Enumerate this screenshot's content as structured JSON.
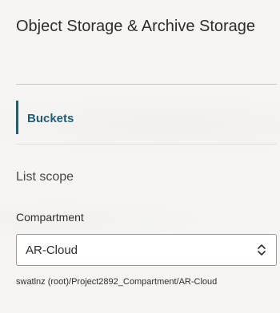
{
  "header": {
    "title": "Object Storage & Archive Storage"
  },
  "nav": {
    "items": [
      {
        "label": "Buckets",
        "active": true
      }
    ]
  },
  "scope": {
    "heading": "List scope",
    "compartment_label": "Compartment",
    "compartment_value": "AR-Cloud",
    "compartment_path": "swatlnz (root)/Project2892_Compartment/AR-Cloud"
  },
  "colors": {
    "accent": "#2c5967",
    "link": "#1f5e74",
    "background": "#f6f5f3"
  },
  "icons": {
    "select": "up-down-chevron-icon"
  }
}
